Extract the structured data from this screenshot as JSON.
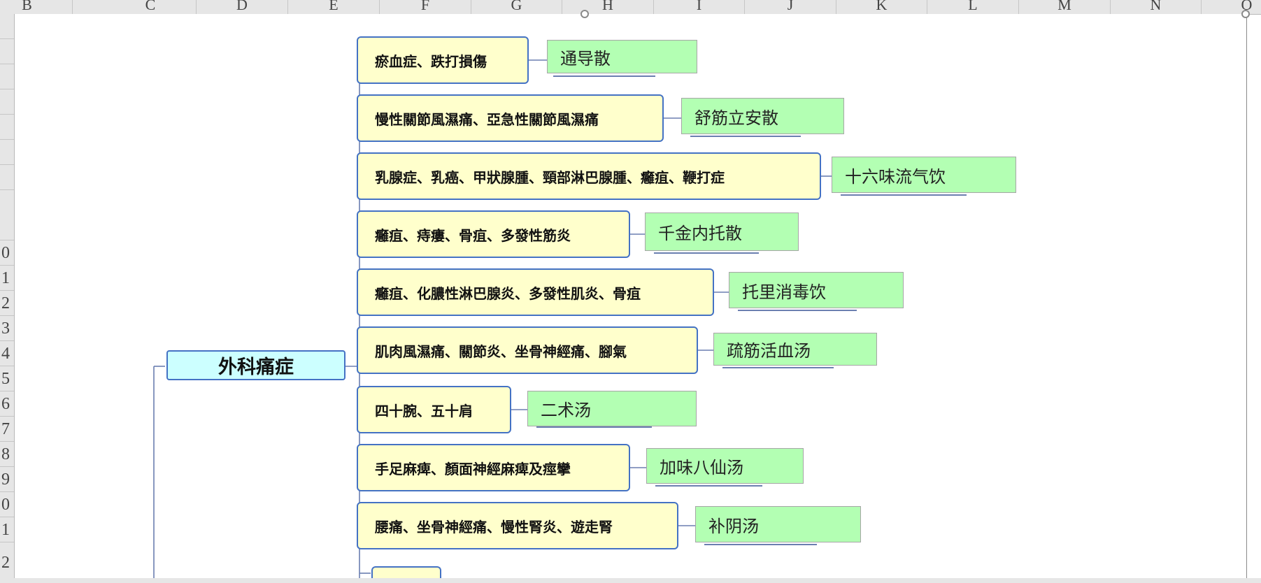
{
  "spreadsheet": {
    "columns": [
      "B",
      "C",
      "D",
      "E",
      "F",
      "G",
      "H",
      "I",
      "J",
      "K",
      "L",
      "M",
      "N",
      "O"
    ],
    "rows": [
      "",
      "",
      "",
      "",
      "",
      "",
      "",
      "",
      "0",
      "1",
      "2",
      "3",
      "4",
      "5",
      "6",
      "7",
      "8",
      "9",
      "0",
      "1",
      "2"
    ]
  },
  "mindmap": {
    "root": "外科痛症",
    "branches": [
      {
        "symptom": "瘀血症、跌打損傷",
        "remedy": "通导散"
      },
      {
        "symptom": "慢性關節風濕痛、亞急性關節風濕痛",
        "remedy": "舒筋立安散"
      },
      {
        "symptom": "乳腺症、乳癌、甲狀腺腫、頸部淋巴腺腫、癰疽、鞭打症",
        "remedy": "十六味流气饮"
      },
      {
        "symptom": "癰疽、痔瘻、骨疽、多發性筋炎",
        "remedy": "千金内托散"
      },
      {
        "symptom": "癰疽、化膿性淋巴腺炎、多發性肌炎、骨疽",
        "remedy": "托里消毒饮"
      },
      {
        "symptom": "肌肉風濕痛、關節炎、坐骨神經痛、腳氣",
        "remedy": "疏筋活血汤"
      },
      {
        "symptom": "四十腕、五十肩",
        "remedy": "二术汤"
      },
      {
        "symptom": "手足麻痺、顏面神經麻痺及痙攣",
        "remedy": "加味八仙汤"
      },
      {
        "symptom": "腰痛、坐骨神經痛、慢性腎炎、遊走腎",
        "remedy": "补阴汤"
      }
    ]
  },
  "colors": {
    "root_fill": "#ccffff",
    "symptom_fill": "#ffffcc",
    "remedy_fill": "#b3ffb3",
    "border_blue": "#4472c4",
    "header_gray": "#e6e6e6"
  }
}
